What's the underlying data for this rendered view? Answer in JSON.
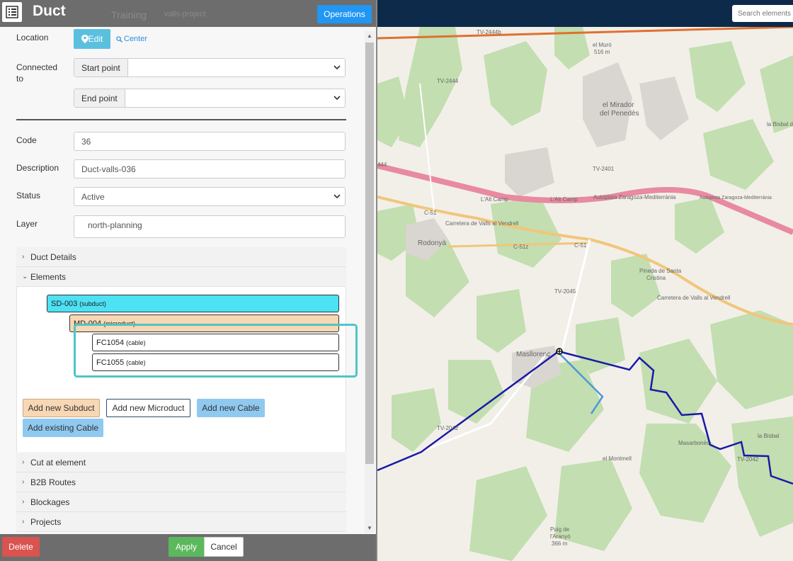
{
  "header": {
    "title": "Duct",
    "ghost_tab_1": "Training",
    "ghost_tab_2": "valls-project",
    "operations_label": "Operations",
    "list_icon": "list-icon"
  },
  "form": {
    "location_label": "Location",
    "edit_label": "Edit",
    "center_label": "Center",
    "connected_label": "Connected to",
    "start_point_label": "Start point",
    "start_point_value": "",
    "end_point_label": "End point",
    "end_point_value": "",
    "code_label": "Code",
    "code_value": "36",
    "description_label": "Description",
    "description_value": "Duct-valls-036",
    "status_label": "Status",
    "status_value": "Active",
    "layer_label": "Layer",
    "layer_value": "north-planning"
  },
  "sections": {
    "duct_details": "Duct Details",
    "elements": "Elements",
    "cut_at_element": "Cut at element",
    "b2b_routes": "B2B Routes",
    "blockages": "Blockages",
    "projects": "Projects"
  },
  "tree": [
    {
      "name": "SD-003",
      "type": "(subduct)",
      "color": "#4de1f4"
    },
    {
      "name": "MD-004",
      "type": "(microduct)",
      "color": "#f8d7b4"
    },
    {
      "name": "FC1054",
      "type": "(cable)",
      "color": "#ffffff"
    },
    {
      "name": "FC1055",
      "type": "(cable)",
      "color": "#ffffff"
    }
  ],
  "element_buttons": {
    "add_subduct": "Add new Subduct",
    "add_microduct": "Add new Microduct",
    "add_cable": "Add new Cable",
    "add_existing_cable": "Add existing Cable"
  },
  "footer": {
    "delete_label": "Delete",
    "apply_label": "Apply",
    "cancel_label": "Cancel"
  },
  "map": {
    "search_placeholder": "Search elements",
    "labels": {
      "tv2444b": "TV-2444b",
      "el_muro": "el Muró",
      "el_muro_alt": "516 m",
      "tv2444": "TV-2444",
      "el_mirador": "el Mirador",
      "del_penedes": "del Penedès",
      "tv2444_edge": "444",
      "tv2401": "TV-2401",
      "la_bisbal": "la Bisbal del",
      "autopista_1": "Autopista Zaragoza-Mediterrània",
      "autopista_2": "Autopista Zaragoza-Mediterrània",
      "alt_camp_1": "L'Alt Camp",
      "alt_camp_2": "L'Alt Camp",
      "c51": "C-51",
      "c51_2": "C-51",
      "c51z": "C-51z",
      "carretera_1": "Carretera de Valls al Vendrell",
      "carretera_2": "Carretera de Valls al Vendrell",
      "rodonya": "Rodonyà",
      "pineda": "Pineda de Santa",
      "pineda2": "Cristina",
      "tv2045": "TV-2045",
      "masllorenc": "Masllorenç",
      "tv2042": "TV-2042",
      "tv2042b": "TV-2042",
      "masarbones": "Masarbonès",
      "puig": "Puig de",
      "puig2": "l'Aranyó",
      "puig3": "366 m",
      "montmell": "el Montmell",
      "la_bisbal2": "la Bisbal"
    }
  },
  "colors": {
    "duct_line": "#1a1aa8",
    "cable_line": "#4a9ad6",
    "autopista": "#e88aa0",
    "road_orange": "#e07030",
    "forest": "#c3deb0",
    "highlight": "#4ec6c6"
  }
}
